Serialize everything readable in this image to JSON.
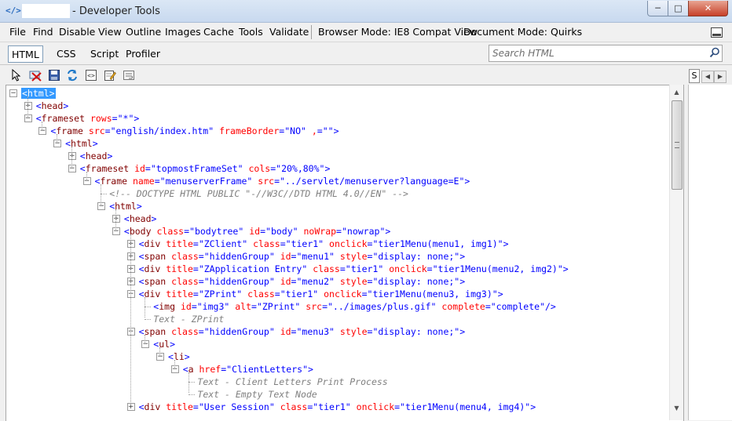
{
  "window": {
    "title": "- Developer Tools",
    "app_icon": "</>"
  },
  "menu": {
    "items": [
      "File",
      "Find",
      "Disable",
      "View",
      "Outline",
      "Images",
      "Cache",
      "Tools",
      "Validate"
    ],
    "browser_mode": "Browser Mode:  IE8 Compat View",
    "document_mode": "Document Mode:  Quirks"
  },
  "tabs": [
    "HTML",
    "CSS",
    "Script",
    "Profiler"
  ],
  "search": {
    "placeholder": "Search HTML"
  },
  "toolbar_icons": [
    "select-element-icon",
    "clear-browser-cache-icon",
    "save-icon",
    "refresh-icon",
    "dom-toggle-icon",
    "edit-icon",
    "word-wrap-icon"
  ],
  "right_pane": {
    "tab_label": "S"
  },
  "tree": {
    "rows": [
      {
        "toggle": "minus",
        "text": "<html>",
        "selected": true
      },
      {
        "toggle": "plus",
        "text": "<head>"
      },
      {
        "toggle": "minus",
        "text": "<frameset rows=\"*\">"
      },
      {
        "toggle": "minus",
        "text": "<frame src=\"english/index.htm\" frameBorder=\"NO\" ,=\"\">"
      },
      {
        "toggle": "minus",
        "text": "<html>"
      },
      {
        "toggle": "plus",
        "text": "<head>"
      },
      {
        "toggle": "minus",
        "text": "<frameset id=\"topmostFrameSet\" cols=\"20%,80%\">"
      },
      {
        "toggle": "minus",
        "text": "<frame name=\"menuserverFrame\" src=\"../servlet/menuserver?language=E\">"
      },
      {
        "toggle": "none",
        "text": "<!-- DOCTYPE HTML PUBLIC \"-//W3C//DTD HTML 4.0//EN\" -->"
      },
      {
        "toggle": "minus",
        "text": "<html>"
      },
      {
        "toggle": "plus",
        "text": "<head>"
      },
      {
        "toggle": "minus",
        "text": "<body class=\"bodytree\" id=\"body\" noWrap=\"nowrap\">"
      },
      {
        "toggle": "plus",
        "text": "<div title=\"ZClient\" class=\"tier1\" onclick=\"tier1Menu(menu1, img1)\">"
      },
      {
        "toggle": "plus",
        "text": "<span class=\"hiddenGroup\" id=\"menu1\" style=\"display: none;\">"
      },
      {
        "toggle": "plus",
        "text": "<div title=\"ZApplication Entry\" class=\"tier1\" onclick=\"tier1Menu(menu2, img2)\">"
      },
      {
        "toggle": "plus",
        "text": "<span class=\"hiddenGroup\" id=\"menu2\" style=\"display: none;\">"
      },
      {
        "toggle": "minus",
        "text": "<div title=\"ZPrint\" class=\"tier1\" onclick=\"tier1Menu(menu3, img3)\">"
      },
      {
        "toggle": "none",
        "text": "<img id=\"img3\" alt=\"ZPrint\" src=\"../images/plus.gif\" complete=\"complete\"/>"
      },
      {
        "toggle": "none",
        "text": "Text -  ZPrint"
      },
      {
        "toggle": "minus",
        "text": "<span class=\"hiddenGroup\" id=\"menu3\" style=\"display: none;\">"
      },
      {
        "toggle": "minus",
        "text": "<ul>"
      },
      {
        "toggle": "minus",
        "text": "<li>"
      },
      {
        "toggle": "minus",
        "text": "<a href=\"ClientLetters\">"
      },
      {
        "toggle": "none",
        "text": "Text - Client Letters Print Process"
      },
      {
        "toggle": "none",
        "text": "Text - Empty Text Node"
      },
      {
        "toggle": "plus",
        "text": "<div title=\"User Session\" class=\"tier1\" onclick=\"tier1Menu(menu4, img4)\">"
      }
    ]
  }
}
